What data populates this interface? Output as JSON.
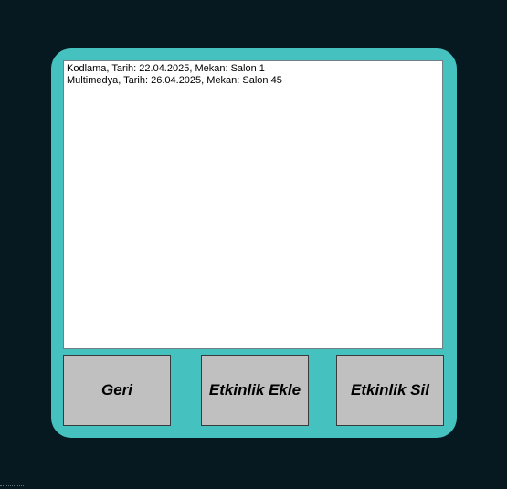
{
  "colors": {
    "background": "#061820",
    "panel": "#45c1bf",
    "listbox": "#ffffff",
    "button": "#c0c0c0"
  },
  "events_list": {
    "items": [
      "Kodlama, Tarih: 22.04.2025, Mekan: Salon 1",
      "Multimedya, Tarih: 26.04.2025, Mekan: Salon 45"
    ]
  },
  "buttons": {
    "back_label": "Geri",
    "add_event_label": "Etkinlik Ekle",
    "delete_event_label": "Etkinlik Sil"
  }
}
